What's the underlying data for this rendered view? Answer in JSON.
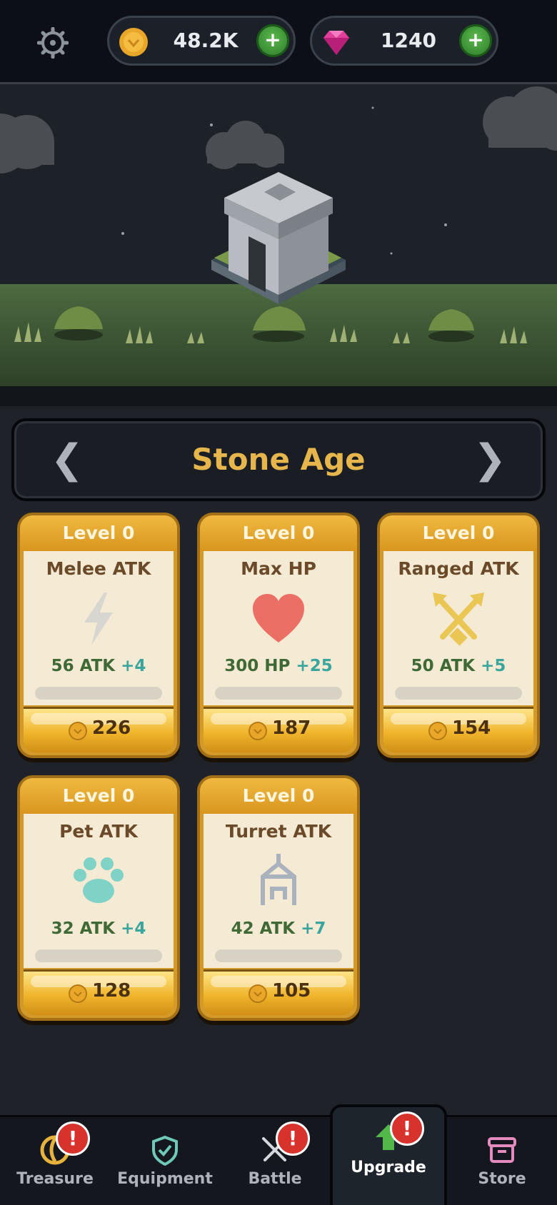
{
  "currency": {
    "coins": "48.2K",
    "gems": "1240",
    "add_label": "+"
  },
  "era": {
    "title": "Stone Age",
    "prev": "❮",
    "next": "❯"
  },
  "cards": [
    {
      "level": "Level 0",
      "name": "Melee ATK",
      "stat": "56 ATK",
      "inc": "+4",
      "price": "226",
      "icon": "lightning-icon"
    },
    {
      "level": "Level 0",
      "name": "Max HP",
      "stat": "300 HP",
      "inc": "+25",
      "price": "187",
      "icon": "heart-icon"
    },
    {
      "level": "Level 0",
      "name": "Ranged ATK",
      "stat": "50 ATK",
      "inc": "+5",
      "price": "154",
      "icon": "crossed-arrows-icon"
    },
    {
      "level": "Level 0",
      "name": "Pet ATK",
      "stat": "32 ATK",
      "inc": "+4",
      "price": "128",
      "icon": "paw-icon"
    },
    {
      "level": "Level 0",
      "name": "Turret ATK",
      "stat": "42 ATK",
      "inc": "+7",
      "price": "105",
      "icon": "turret-icon"
    }
  ],
  "nav": {
    "treasure": "Treasure",
    "equipment": "Equipment",
    "battle": "Battle",
    "upgrade": "Upgrade",
    "store": "Store",
    "badge": "!"
  },
  "colors": {
    "gold": "#e6b64d",
    "card": "#d39a2a",
    "alert": "#d8322d",
    "grass": "#4c6a40"
  }
}
